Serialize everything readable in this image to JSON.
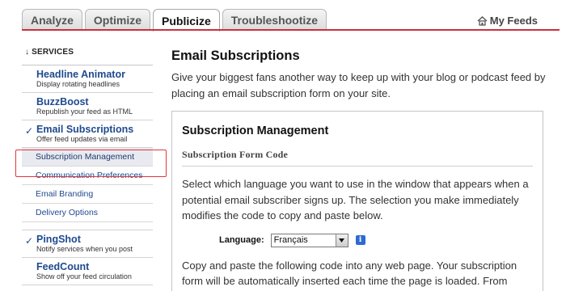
{
  "tabs": [
    {
      "label": "Analyze"
    },
    {
      "label": "Optimize"
    },
    {
      "label": "Publicize"
    },
    {
      "label": "Troubleshootize"
    }
  ],
  "active_tab": "Publicize",
  "my_feeds": "My Feeds",
  "sidebar": {
    "heading": "↓ SERVICES",
    "services": [
      {
        "title": "Headline Animator",
        "desc": "Display rotating headlines",
        "checked": false
      },
      {
        "title": "BuzzBoost",
        "desc": "Republish your feed as HTML",
        "checked": false
      },
      {
        "title": "Email Subscriptions",
        "desc": "Offer feed updates via email",
        "checked": true
      }
    ],
    "subitems": [
      {
        "label": "Subscription Management",
        "current": true
      },
      {
        "label": "Communication Preferences"
      },
      {
        "label": "Email Branding"
      },
      {
        "label": "Delivery Options"
      }
    ],
    "services2": [
      {
        "title": "PingShot",
        "desc": "Notify services when you post",
        "checked": true
      },
      {
        "title": "FeedCount",
        "desc": "Show off your feed circulation",
        "checked": false
      }
    ]
  },
  "main": {
    "title": "Email Subscriptions",
    "intro": "Give your biggest fans another way to keep up with your blog or podcast feed by placing an email subscription form on your site.",
    "panel": {
      "title": "Subscription Management",
      "section": "Subscription Form Code",
      "para1": "Select which language you want to use in the window that appears when a potential email subscriber signs up. The selection you make immediately modifies the code to copy and paste below.",
      "language_label": "Language:",
      "language_value": "Français",
      "para2": "Copy and paste the following code into any web page. Your subscription form will be automatically inserted each time the page is loaded. From"
    }
  },
  "colors": {
    "accent": "#c8323c",
    "link": "#1f4a8e",
    "highlight_box": "#e0383b"
  }
}
